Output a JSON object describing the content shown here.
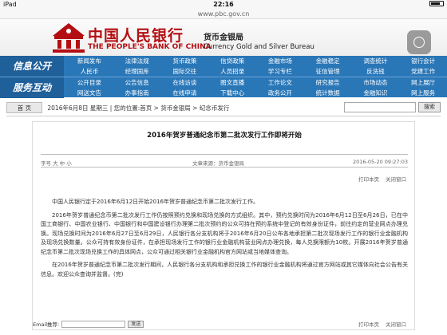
{
  "status": {
    "device": "iPad",
    "time": "22:16",
    "battery": ""
  },
  "url": "www.pbc.gov.cn",
  "header": {
    "cn_name": "中国人民银行",
    "en_name": "THE PEOPLE'S BANK OF CHINA",
    "bureau_cn": "货币金银局",
    "bureau_en": "Currency Gold and Silver Bureau"
  },
  "nav": {
    "section1": "信息公开",
    "section2": "服务互动",
    "row1": [
      "新闻发布",
      "法律法规",
      "货币政策",
      "信贷政策",
      "金融市场",
      "金融稳定",
      "调查统计",
      "银行会计",
      "支付体系",
      "金融科技"
    ],
    "row2": [
      "人民币",
      "经理国库",
      "国际交往",
      "人员招录",
      "学习专栏",
      "征信管理",
      "反洗钱",
      "党建工作",
      "工会工作"
    ],
    "row3": [
      "公开目录",
      "公告信息",
      "在线访谈",
      "图文直播",
      "工作论文",
      "研究报告",
      "市场动态",
      "网上展厅",
      "报告下载",
      "报刊年鉴"
    ],
    "row4": [
      "网送文告",
      "办事指南",
      "在线申请",
      "下载中心",
      "政务公开",
      "统计数据",
      "金融知识",
      "网上服务",
      "关于我们"
    ]
  },
  "breadcrumb": {
    "home": "首 页",
    "path": "2016年6月8日 星期三 | 您的位置:首页 > 货币金银局 > 纪念币发行",
    "search_placeholder": "",
    "search_button": "搜索"
  },
  "article": {
    "title": "2016年贺岁普通纪念币第二批次发行工作即将开始",
    "font_size": "字号 大 中 小",
    "source": "文章来源：货币金银局",
    "date": "2016-05-20 09:27:03",
    "print": "打印本页",
    "close": "关闭窗口",
    "paragraphs": [
      "中国人民银行定于2016年6月12日开始2016年贺岁普通纪念币第二批次发行工作。",
      "2016年贺岁普通纪念币第二批次发行工作仍按照预约兑换和现场兑换的方式组织。其中，预约兑换时间为2016年6月12日至6月26日，已在中国工商银行、中国农业银行、中国银行和中国建设银行办理第二批次预约的公众可持在预约系统中登记的有效身份证件，前往约定的营业网点办理兑换。现场兑换时间为2016年6月27日至6月29日，人民银行各分支机构将于2016年6月20日公布各地承担第二批次现场发行工作的银行业金融机构及现场兑换数量。公众可持有效身份证件，在承担现场发行工作的银行业金融机构营业网点办理兑换，每人兑换限额为10枚。开展2016年贺岁普通纪念币第二批次现场兑换工作的具体网点，公众可通过相关银行业金融机构官方网站或当地媒体查询。",
      "在2016年贺岁普通纪念币第二批次发行期间，人民银行各分支机构和承担兑换工作的银行业金融机构将通过官方网站或其它媒体向社会公告有关信息。欢迎公众查询并监督。(完)"
    ],
    "email_label": "Email推荐:",
    "email_button": "发送",
    "print_bottom": "打印本页",
    "close_bottom": "关闭窗口"
  },
  "colors": {
    "nav_blue": "#2a77b8",
    "brand_red": "#b40e12"
  }
}
